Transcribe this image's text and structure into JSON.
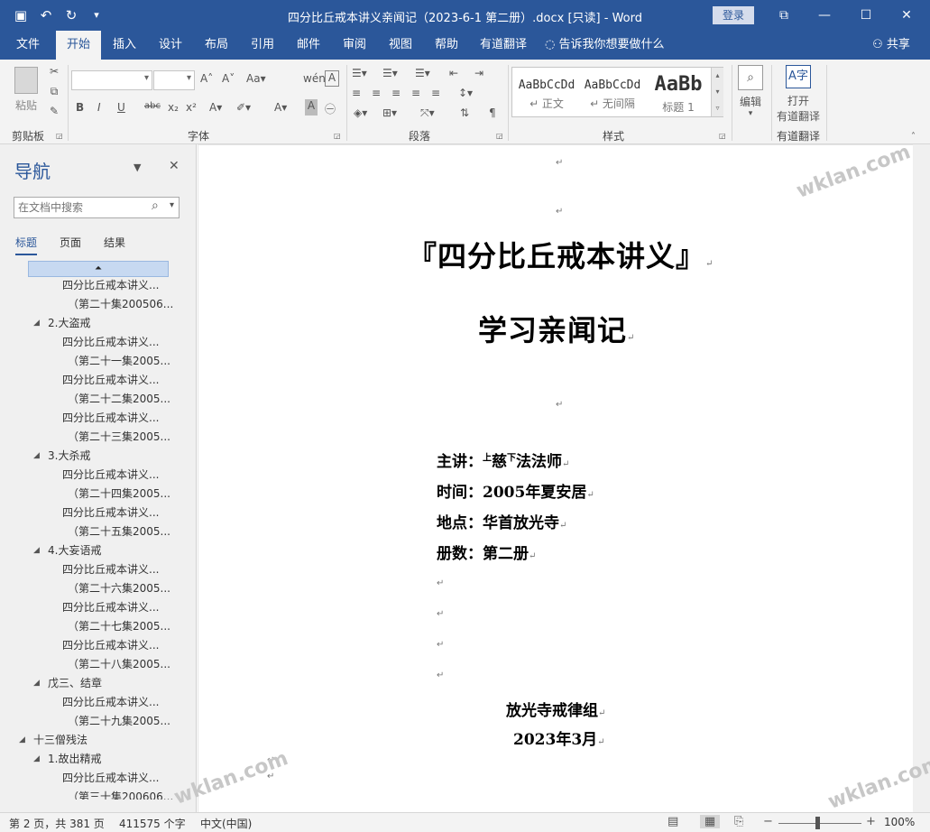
{
  "window": {
    "title": "四分比丘戒本讲义亲闻记（2023-6-1 第二册）.docx [只读] - Word",
    "login_label": "登录",
    "controls": [
      "restore-ribbon-icon",
      "minimize-icon",
      "maximize-icon",
      "close-icon"
    ]
  },
  "qat": {
    "icons": [
      "save-icon",
      "undo-icon",
      "redo-icon",
      "customize-icon"
    ]
  },
  "ribbon_tabs": [
    {
      "label": "文件"
    },
    {
      "label": "开始"
    },
    {
      "label": "插入"
    },
    {
      "label": "设计"
    },
    {
      "label": "布局"
    },
    {
      "label": "引用"
    },
    {
      "label": "邮件"
    },
    {
      "label": "审阅"
    },
    {
      "label": "视图"
    },
    {
      "label": "帮助"
    },
    {
      "label": "有道翻译"
    }
  ],
  "tell_me": "告诉我你想要做什么",
  "share": "共享",
  "ribbon": {
    "groups": {
      "clipboard": "剪贴板",
      "font": "字体",
      "paragraph": "段落",
      "styles": "样式",
      "youdao": "有道翻译"
    },
    "paste": "粘贴",
    "edit": "编辑",
    "open_translate": "打开",
    "open_translate_2": "有道翻译",
    "styles": [
      {
        "preview": "AaBbCcDd",
        "name": "↵ 正文"
      },
      {
        "preview": "AaBbCcDd",
        "name": "↵ 无间隔"
      },
      {
        "preview": "AaBb",
        "name": "标题 1"
      }
    ],
    "font_buttons": [
      "B",
      "I",
      "U",
      "abc",
      "x₂",
      "x²"
    ]
  },
  "nav": {
    "title": "导航",
    "search_placeholder": "在文档中搜索",
    "tabs": [
      {
        "label": "标题"
      },
      {
        "label": "页面"
      },
      {
        "label": "结果"
      }
    ],
    "items": [
      {
        "text": "四分比丘戒本讲义..."
      },
      {
        "text": "（第二十集200506..."
      },
      {
        "text": "2.大盗戒"
      },
      {
        "text": "四分比丘戒本讲义..."
      },
      {
        "text": "（第二十一集2005..."
      },
      {
        "text": "四分比丘戒本讲义..."
      },
      {
        "text": "（第二十二集2005..."
      },
      {
        "text": "四分比丘戒本讲义..."
      },
      {
        "text": "（第二十三集2005..."
      },
      {
        "text": "3.大杀戒"
      },
      {
        "text": "四分比丘戒本讲义..."
      },
      {
        "text": "（第二十四集2005..."
      },
      {
        "text": "四分比丘戒本讲义..."
      },
      {
        "text": "（第二十五集2005..."
      },
      {
        "text": "4.大妄语戒"
      },
      {
        "text": "四分比丘戒本讲义..."
      },
      {
        "text": "（第二十六集2005..."
      },
      {
        "text": "四分比丘戒本讲义..."
      },
      {
        "text": "（第二十七集2005..."
      },
      {
        "text": "四分比丘戒本讲义..."
      },
      {
        "text": "（第二十八集2005..."
      },
      {
        "text": "戊三、结章"
      },
      {
        "text": "四分比丘戒本讲义..."
      },
      {
        "text": "（第二十九集2005..."
      },
      {
        "text": "十三僧残法"
      },
      {
        "text": "1.故出精戒"
      },
      {
        "text": "四分比丘戒本讲义..."
      },
      {
        "text": "（第三十集200606..."
      }
    ]
  },
  "document": {
    "title": "『四分比丘戒本讲义』",
    "subtitle": "学习亲闻记",
    "info": [
      {
        "label": "主讲：",
        "sup1": "上",
        "name1": "慈",
        "sup2": "下",
        "name2": "法法师"
      },
      {
        "label": "时间：",
        "value": "2005年夏安居"
      },
      {
        "label": "地点：",
        "value": "华首放光寺"
      },
      {
        "label": "册数：",
        "value": "第二册"
      }
    ],
    "publisher": "放光寺戒律组",
    "date": "2023年3月",
    "para_mark": "↵"
  },
  "status": {
    "page": "第 2 页，共 381 页",
    "words": "411575 个字",
    "language": "中文(中国)",
    "zoom": "100%"
  },
  "watermark": "wklan.com"
}
